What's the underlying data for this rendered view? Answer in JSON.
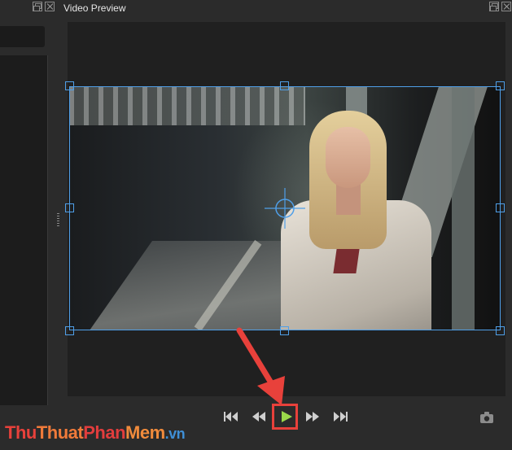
{
  "preview_panel": {
    "title": "Video Preview"
  },
  "window_buttons": {
    "restore_icon": "restore-icon",
    "close_icon": "close-icon"
  },
  "transport": {
    "buttons": [
      {
        "name": "first-frame",
        "icon": "skip-to-start-icon"
      },
      {
        "name": "rewind",
        "icon": "rewind-icon"
      },
      {
        "name": "play",
        "icon": "play-icon"
      },
      {
        "name": "fast-forward",
        "icon": "fast-forward-icon"
      },
      {
        "name": "last-frame",
        "icon": "skip-to-end-icon"
      }
    ],
    "snapshot_icon": "camera-icon"
  },
  "colors": {
    "selection_box": "#4f9fe8",
    "highlight": "#e8413b",
    "play_icon": "#9bd84a"
  },
  "watermark": {
    "part1": "Thu",
    "part2": "Thuat",
    "part3": "Phan",
    "part4": "Mem",
    "part5": ".vn"
  }
}
